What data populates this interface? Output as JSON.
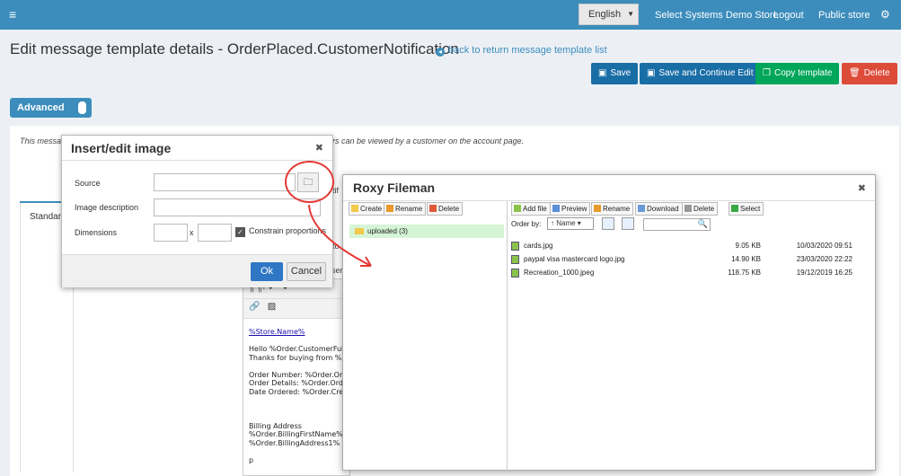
{
  "topbar": {
    "language": "English",
    "store_link": "Select Systems Demo Store",
    "logout": "Logout",
    "public_store": "Public store"
  },
  "page": {
    "title": "Edit message template details - OrderPlaced.CustomerNotification",
    "back_link": "back to return message template list"
  },
  "actions": {
    "save": "Save",
    "save_continue": "Save and Continue Edit",
    "copy": "Copy template",
    "delete": "Delete"
  },
  "advanced_toggle": "Advanced",
  "card": {
    "note_start": "This messag",
    "note_end": "rders can be viewed by a customer on the account page.",
    "tab_standard": "Standard",
    "frag_notif": "tif",
    "frag_to": "to",
    "frag_ser": "ser"
  },
  "editor": {
    "tools_row1": "¶  ¶·   ↶   ↷",
    "lines": [
      {
        "text": "%Store.Name%",
        "link": true
      },
      {
        "text": "",
        "link": false
      },
      {
        "text": "Hello %Order.CustomerFul",
        "link": false
      },
      {
        "text": "Thanks for buying from %",
        "link": false
      },
      {
        "text": "",
        "link": false
      },
      {
        "text": "Order Number: %Order.Or",
        "link": false
      },
      {
        "text": "Order Details: %Order.Ord",
        "link": false
      },
      {
        "text": "Date Ordered: %Order.Cre",
        "link": false
      },
      {
        "text": "",
        "link": false
      },
      {
        "text": "",
        "link": false
      },
      {
        "text": "",
        "link": false
      },
      {
        "text": "Billing Address",
        "link": false
      },
      {
        "text": "%Order.BillingFirstName%",
        "link": false
      },
      {
        "text": "%Order.BillingAddress1%",
        "link": false
      },
      {
        "text": "",
        "link": false
      },
      {
        "text": "p",
        "link": false
      }
    ]
  },
  "insert_dialog": {
    "title": "Insert/edit image",
    "source_label": "Source",
    "description_label": "Image description",
    "dimensions_label": "Dimensions",
    "x_sep": "x",
    "constrain_label": "Constrain proportions",
    "ok": "Ok",
    "cancel": "Cancel"
  },
  "fileman": {
    "title": "Roxy Fileman",
    "dir_tools": {
      "create": "Create",
      "rename": "Rename",
      "delete": "Delete"
    },
    "file_tools": {
      "add": "Add file",
      "preview": "Preview",
      "rename": "Rename",
      "download": "Download",
      "delete": "Delete",
      "select": "Select"
    },
    "folder": "uploaded (3)",
    "order_by_label": "Order by:",
    "order_by_value": "↑ Name",
    "files": [
      {
        "name": "cards.jpg",
        "size": "9.05 KB",
        "date": "10/03/2020 09:51"
      },
      {
        "name": "paypal visa mastercard logo.jpg",
        "size": "14.90 KB",
        "date": "23/03/2020 22:22"
      },
      {
        "name": "Recreation_1000.jpeg",
        "size": "118.75 KB",
        "date": "19/12/2019 16:25"
      }
    ]
  },
  "colors": {
    "primary": "#3c8dbc",
    "save_button": "#1a6ea6",
    "copy_button": "#00a65a",
    "delete_button": "#dd4b39",
    "annotation": "#e53935"
  }
}
